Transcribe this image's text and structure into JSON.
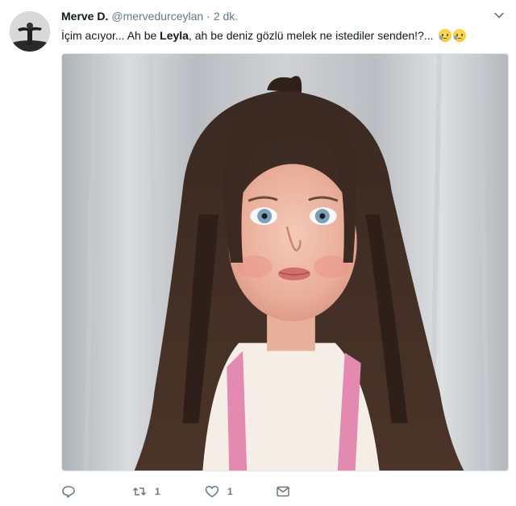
{
  "tweet": {
    "author_name": "Merve D.",
    "handle": "@mervedurceylan",
    "separator": "·",
    "time": "2 dk.",
    "text_part1": "İçim acıyor... Ah be ",
    "text_bold": "Leyla",
    "text_part2": ", ah be deniz gözlü melek ne istediler senden!?...",
    "emojis": [
      "crying-face-icon",
      "crying-face-icon"
    ]
  },
  "actions": {
    "reply_count": "",
    "retweet_count": "1",
    "like_count": "1"
  },
  "colors": {
    "text": "#14171a",
    "secondary": "#657786",
    "border": "#e1e8ed"
  }
}
